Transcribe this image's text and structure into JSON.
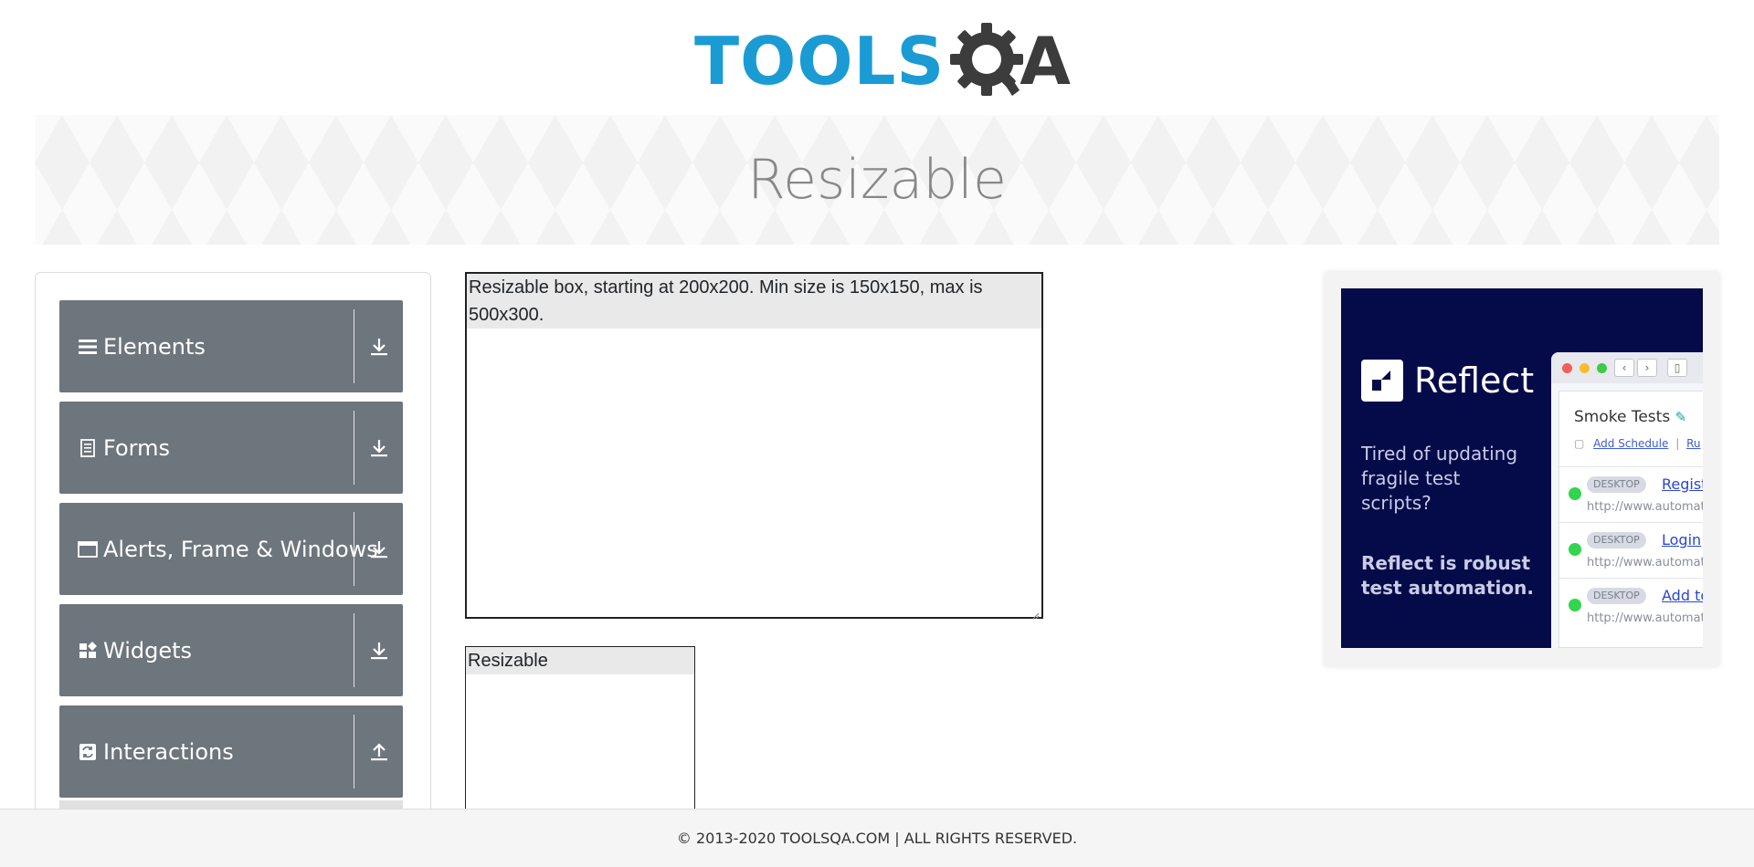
{
  "logo": {
    "part1": "TOOLS",
    "part2": "QA"
  },
  "banner": {
    "title": "Resizable"
  },
  "sidebar": {
    "groups": [
      {
        "label": "Elements",
        "icon": "hamburger-icon",
        "arrow": "download-icon"
      },
      {
        "label": "Forms",
        "icon": "document-icon",
        "arrow": "download-icon"
      },
      {
        "label": "Alerts, Frame & Windows",
        "icon": "window-icon",
        "arrow": "download-icon"
      },
      {
        "label": "Widgets",
        "icon": "widgets-icon",
        "arrow": "download-icon"
      },
      {
        "label": "Interactions",
        "icon": "interactions-icon",
        "arrow": "upload-icon"
      }
    ]
  },
  "main": {
    "box_restricted_text": "Resizable box, starting at 200x200. Min size is 150x150, max is 500x300.",
    "box_free_text": "Resizable"
  },
  "ad": {
    "brand": "Reflect",
    "tagline1": "Tired of updating fragile test scripts?",
    "tagline2": "Reflect is robust test automation.",
    "app_title": "Smoke Tests",
    "add_schedule": "Add Schedule",
    "separator": "|",
    "run_label": "Ru",
    "rows": [
      {
        "badge": "DESKTOP",
        "name": "Registr",
        "url": "http://www.automat"
      },
      {
        "badge": "DESKTOP",
        "name": "Login",
        "url": "http://www.automat"
      },
      {
        "badge": "DESKTOP",
        "name": "Add to",
        "url": "http://www.automat"
      }
    ],
    "colors": {
      "background": "#050a49",
      "status_green": "#33d44e",
      "link_blue": "#2946d6"
    }
  },
  "footer": {
    "text": "© 2013-2020 TOOLSQA.COM | ALL RIGHTS RESERVED."
  },
  "colors": {
    "sidebar_group_bg": "#6d757d",
    "logo_blue": "#1b9bd4",
    "logo_dark": "#3c3c3c",
    "banner_text": "#888888"
  }
}
